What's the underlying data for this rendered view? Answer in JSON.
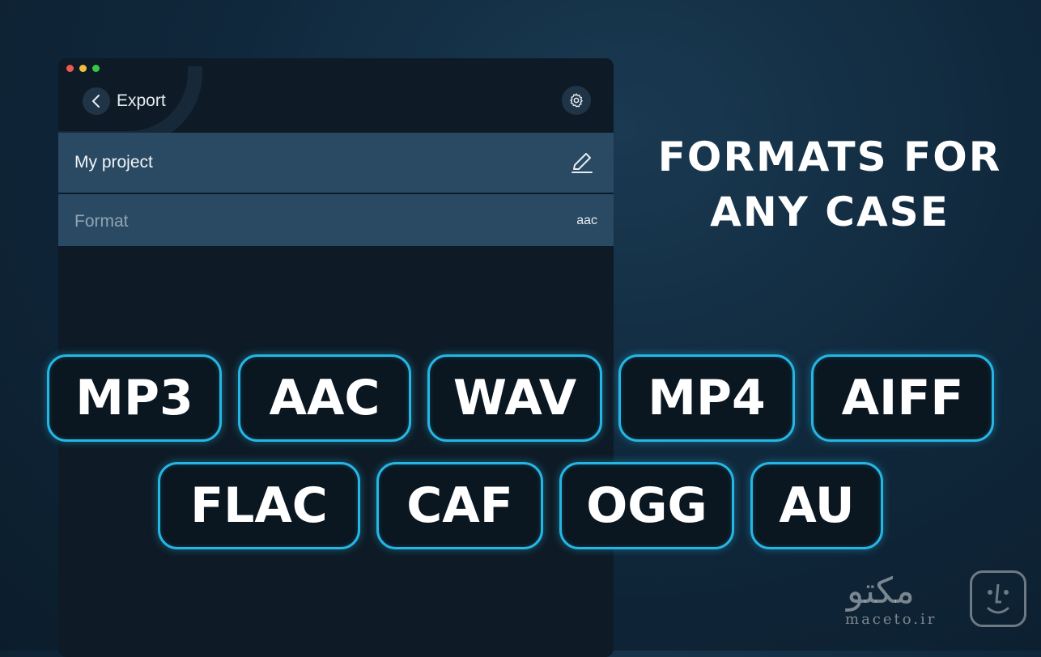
{
  "window": {
    "header": {
      "title": "Export",
      "back_icon": "chevron-left-icon",
      "settings_icon": "gear-icon"
    },
    "project": {
      "name": "My project",
      "edit_icon": "pencil-icon"
    },
    "format": {
      "label": "Format",
      "value": "aac"
    }
  },
  "headline": {
    "line1": "FORMATS FOR",
    "line2": "ANY CASE"
  },
  "formats_row1": [
    "MP3",
    "AAC",
    "WAV",
    "MP4",
    "AIFF"
  ],
  "formats_row2": [
    "FLAC",
    "CAF",
    "OGG",
    "AU"
  ],
  "brand": {
    "name_fa": "مکتو",
    "domain": "maceto.ir"
  },
  "colors": {
    "accent": "#26b6e4",
    "background": "#10283c",
    "row": "#2a4a63"
  }
}
